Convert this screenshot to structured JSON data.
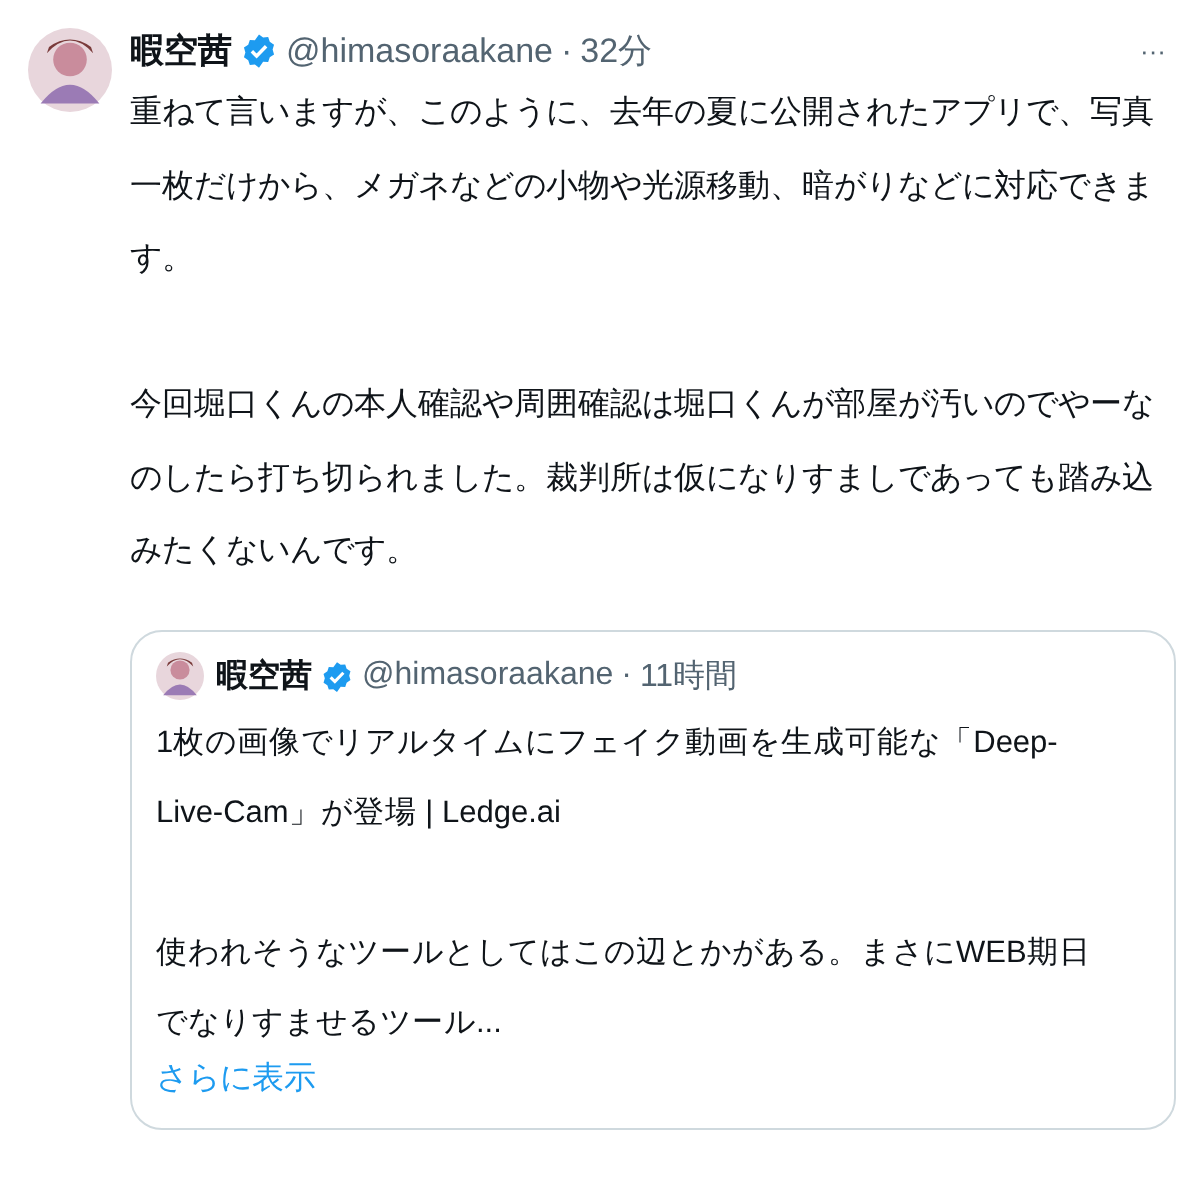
{
  "post": {
    "author": "暇空茜",
    "verified": true,
    "handle": "@himasoraakane",
    "separator": "·",
    "time": "32分",
    "more": "···",
    "paragraphs": [
      "重ねて言いますが、このように、去年の夏に公開されたアプリで、写真一枚だけから、メガネなどの小物や光源移動、暗がりなどに対応できます。",
      "今回堀口くんの本人確認や周囲確認は堀口くんが部屋が汚いのでやーなのしたら打ち切られました。裁判所は仮になりすましであっても踏み込みたくないんです。"
    ],
    "quote": {
      "author": "暇空茜",
      "verified": true,
      "handle": "@himasoraakane",
      "separator": "·",
      "time": "11時間",
      "paragraphs": [
        "1枚の画像でリアルタイムにフェイク動画を生成可能な「Deep-Live-Cam」が登場 | Ledge.ai",
        "使われそうなツールとしてはこの辺とかがある。まさにWEB期日でなりすませるツール..."
      ],
      "show_more": "さらに表示"
    }
  }
}
